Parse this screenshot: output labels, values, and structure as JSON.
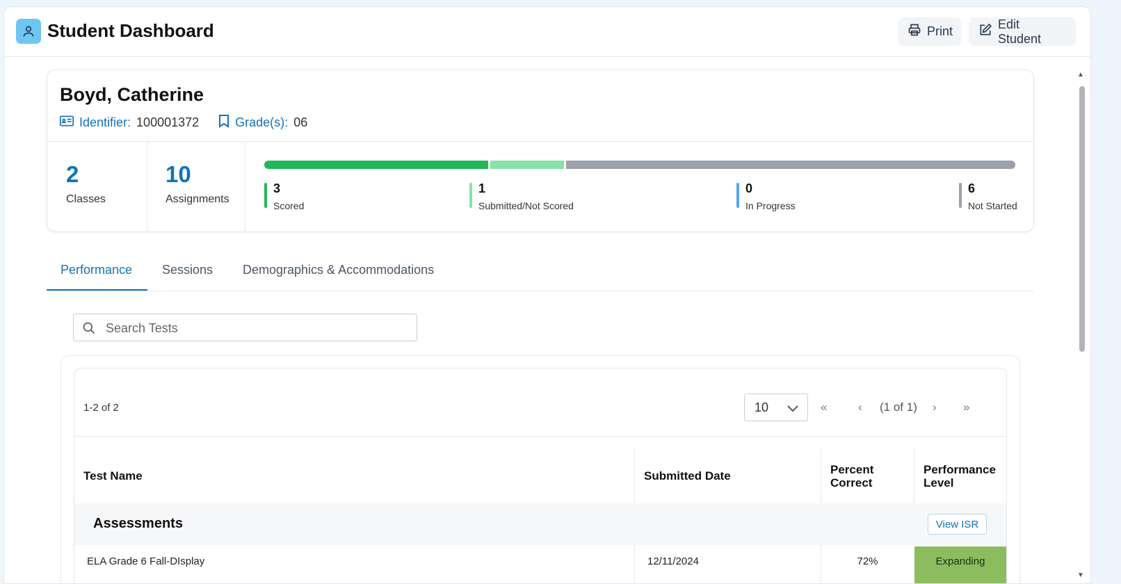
{
  "header": {
    "title": "Student Dashboard",
    "print_label": "Print",
    "edit_label": "Edit Student"
  },
  "student": {
    "name": "Boyd, Catherine",
    "identifier_label": "Identifier:",
    "identifier": "100001372",
    "grade_label": "Grade(s):",
    "grade": "06"
  },
  "stats": {
    "classes_count": "2",
    "classes_label": "Classes",
    "assignments_count": "10",
    "assignments_label": "Assignments"
  },
  "progress": {
    "scored": {
      "count": "3",
      "label": "Scored",
      "color": "#22b857"
    },
    "submitted": {
      "count": "1",
      "label": "Submitted/Not Scored",
      "color": "#86e3a8"
    },
    "in_progress": {
      "count": "0",
      "label": "In Progress",
      "color": "#5aa6ee"
    },
    "not_started": {
      "count": "6",
      "label": "Not Started",
      "color": "#9ca0a8"
    }
  },
  "tabs": [
    {
      "label": "Performance",
      "active": true
    },
    {
      "label": "Sessions",
      "active": false
    },
    {
      "label": "Demographics & Accommodations",
      "active": false
    }
  ],
  "search": {
    "placeholder": "Search Tests"
  },
  "table": {
    "range_text": "1-2 of 2",
    "page_size": "10",
    "first_glyph": "«",
    "prev_glyph": "‹",
    "page_info": "(1 of 1)",
    "next_glyph": "›",
    "last_glyph": "»",
    "columns": [
      "Test Name",
      "Submitted Date",
      "Percent Correct",
      "Performance Level"
    ],
    "group": {
      "title": "Assessments",
      "button_label": "View ISR"
    },
    "rows": [
      {
        "test_name": "ELA Grade 6  Fall-DIsplay",
        "submitted_date": "12/11/2024",
        "percent_correct": "72%",
        "performance_level": "Expanding"
      }
    ]
  },
  "colors": {
    "accent": "#1273b8",
    "expanding": "#8bbd5e"
  }
}
